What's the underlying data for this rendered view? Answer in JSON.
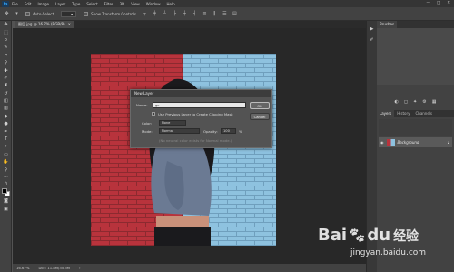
{
  "menubar": {
    "logo": "Ps",
    "items": [
      "File",
      "Edit",
      "Image",
      "Layer",
      "Type",
      "Select",
      "Filter",
      "3D",
      "View",
      "Window",
      "Help"
    ],
    "controls": [
      "—",
      "□",
      "✕"
    ]
  },
  "options": {
    "auto_select_label": "Auto-Select:",
    "transform_label": "Show Transform Controls"
  },
  "document": {
    "tab_title": "图层.jpg @ 16.7% (RGB/8)",
    "tab_close": "×"
  },
  "status": {
    "zoom": "16.67%",
    "doc_info": "Doc: 11.8M/35.3M"
  },
  "panels": {
    "top_tab": "Brushes",
    "layers_tabs": [
      "Layers",
      "History",
      "Channels"
    ],
    "layer_name": "Background"
  },
  "dialog": {
    "title": "New Layer",
    "name_label": "Name:",
    "name_value": "gc",
    "clip_label": "Use Previous Layer to Create Clipping Mask",
    "color_label": "Color:",
    "color_value": "None",
    "mode_label": "Mode:",
    "mode_value": "Normal",
    "opacity_label": "Opacity:",
    "opacity_value": "100",
    "opacity_unit": "%",
    "hint": "(No neutral color exists for Normal mode.)",
    "ok_label": "OK",
    "cancel_label": "Cancel"
  },
  "watermark": {
    "brand": "Bai",
    "brand2": "du",
    "cn": "经验",
    "url": "jingyan.baidu.com"
  }
}
